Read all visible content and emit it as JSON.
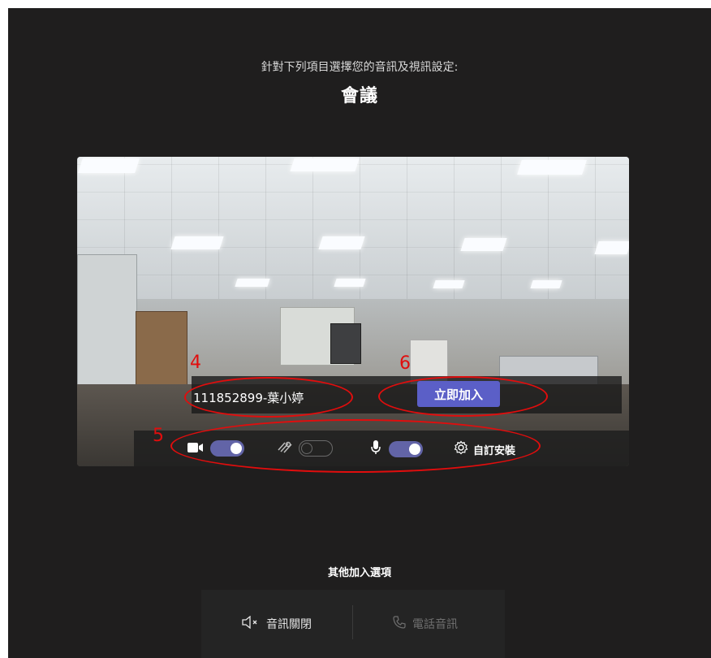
{
  "header": {
    "subtitle": "針對下列項目選擇您的音訊及視訊設定:",
    "title": "會議"
  },
  "preview": {
    "display_name": "111852899-葉小婷",
    "join_button_label": "立即加入"
  },
  "controls": {
    "camera": {
      "icon": "camera-icon",
      "enabled": true
    },
    "background_blur": {
      "icon": "background-blur-icon",
      "enabled": false
    },
    "microphone": {
      "icon": "microphone-icon",
      "enabled": true
    },
    "settings": {
      "icon": "gear-icon",
      "label": "自訂安裝"
    }
  },
  "annotations": [
    "4",
    "5",
    "6"
  ],
  "other_options": {
    "title": "其他加入選項",
    "audio_off": {
      "icon": "speaker-muted-icon",
      "label": "音訊關閉"
    },
    "phone_audio": {
      "icon": "phone-icon",
      "label": "電話音訊"
    }
  },
  "colors": {
    "background": "#1f1e1e",
    "accent": "#5b5fc7",
    "annotation": "#e10d0d"
  }
}
